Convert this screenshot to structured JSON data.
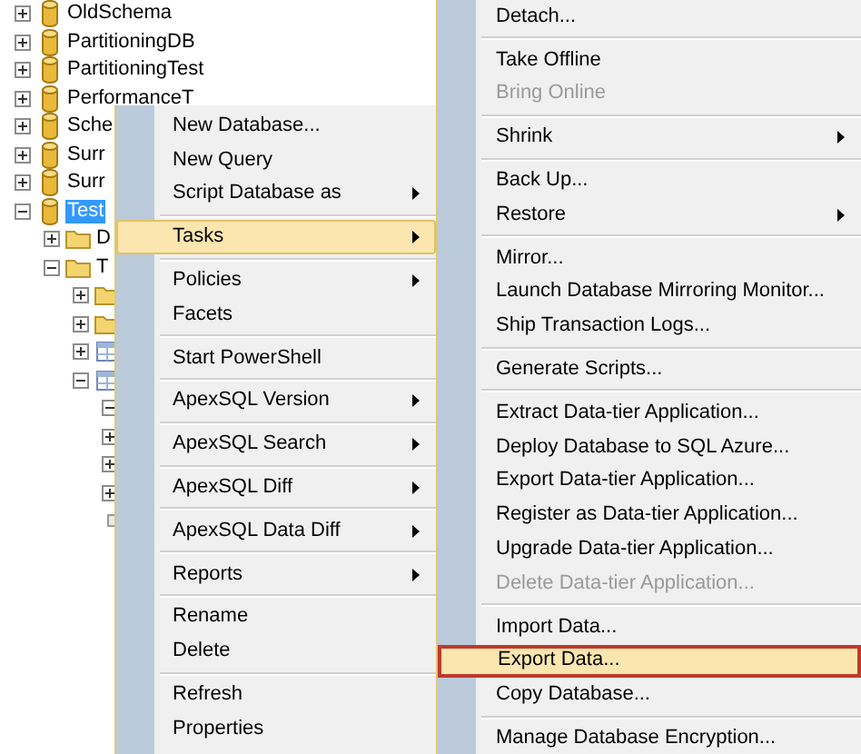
{
  "tree": [
    {
      "kind": "database",
      "label": "OldSchema",
      "expanded": false,
      "selected": false
    },
    {
      "kind": "database",
      "label": "PartitioningDB",
      "expanded": false,
      "selected": false
    },
    {
      "kind": "database",
      "label": "PartitioningTest",
      "expanded": false,
      "selected": false
    },
    {
      "kind": "database",
      "label": "PerformanceT",
      "expanded": false,
      "selected": false
    },
    {
      "kind": "database",
      "label": "Sche",
      "expanded": false,
      "selected": false
    },
    {
      "kind": "database",
      "label": "Surr",
      "expanded": false,
      "selected": false
    },
    {
      "kind": "database",
      "label": "Surr",
      "expanded": false,
      "selected": false
    },
    {
      "kind": "database",
      "label": "Test",
      "expanded": true,
      "selected": true,
      "children": [
        {
          "kind": "folder",
          "label": "D",
          "expanded": false,
          "selected": false
        },
        {
          "kind": "folder",
          "label": "T",
          "expanded": true,
          "selected": false,
          "children": [
            {
              "kind": "folder",
              "expanded": false
            },
            {
              "kind": "folder",
              "expanded": false
            },
            {
              "kind": "table",
              "expanded": false
            },
            {
              "kind": "table",
              "expanded": true,
              "children": [
                {
                  "expanded": true
                },
                {
                  "expanded": false
                },
                {
                  "expanded": false
                },
                {
                  "expanded": false
                },
                {
                  "kind": "leaf"
                }
              ]
            }
          ]
        }
      ]
    }
  ],
  "context_menu": {
    "items": [
      {
        "kind": "item",
        "label": "New Database...",
        "selected": false,
        "disabled": false,
        "submenu": false
      },
      {
        "kind": "item",
        "label": "New Query",
        "selected": false,
        "disabled": false,
        "submenu": false
      },
      {
        "kind": "item",
        "label": "Script Database as",
        "selected": false,
        "disabled": false,
        "submenu": true
      },
      {
        "kind": "separator"
      },
      {
        "kind": "item",
        "label": "Tasks",
        "selected": true,
        "disabled": false,
        "submenu": true
      },
      {
        "kind": "separator"
      },
      {
        "kind": "item",
        "label": "Policies",
        "selected": false,
        "disabled": false,
        "submenu": true
      },
      {
        "kind": "item",
        "label": "Facets",
        "selected": false,
        "disabled": false,
        "submenu": false
      },
      {
        "kind": "separator"
      },
      {
        "kind": "item",
        "label": "Start PowerShell",
        "selected": false,
        "disabled": false,
        "submenu": false
      },
      {
        "kind": "separator"
      },
      {
        "kind": "item",
        "label": "ApexSQL Version",
        "selected": false,
        "disabled": false,
        "submenu": true
      },
      {
        "kind": "separator"
      },
      {
        "kind": "item",
        "label": "ApexSQL Search",
        "selected": false,
        "disabled": false,
        "submenu": true
      },
      {
        "kind": "separator"
      },
      {
        "kind": "item",
        "label": "ApexSQL Diff",
        "selected": false,
        "disabled": false,
        "submenu": true
      },
      {
        "kind": "separator"
      },
      {
        "kind": "item",
        "label": "ApexSQL Data Diff",
        "selected": false,
        "disabled": false,
        "submenu": true
      },
      {
        "kind": "separator"
      },
      {
        "kind": "item",
        "label": "Reports",
        "selected": false,
        "disabled": false,
        "submenu": true
      },
      {
        "kind": "separator"
      },
      {
        "kind": "item",
        "label": "Rename",
        "selected": false,
        "disabled": false,
        "submenu": false
      },
      {
        "kind": "item",
        "label": "Delete",
        "selected": false,
        "disabled": false,
        "submenu": false
      },
      {
        "kind": "separator"
      },
      {
        "kind": "item",
        "label": "Refresh",
        "selected": false,
        "disabled": false,
        "submenu": false
      },
      {
        "kind": "item",
        "label": "Properties",
        "selected": false,
        "disabled": false,
        "submenu": false
      }
    ]
  },
  "tasks_submenu": {
    "items": [
      {
        "kind": "item",
        "label": "Detach...",
        "selected": false,
        "outlined": false,
        "disabled": false,
        "submenu": false
      },
      {
        "kind": "separator"
      },
      {
        "kind": "item",
        "label": "Take Offline",
        "selected": false,
        "outlined": false,
        "disabled": false,
        "submenu": false
      },
      {
        "kind": "item",
        "label": "Bring Online",
        "selected": false,
        "outlined": false,
        "disabled": true,
        "submenu": false
      },
      {
        "kind": "separator"
      },
      {
        "kind": "item",
        "label": "Shrink",
        "selected": false,
        "outlined": false,
        "disabled": false,
        "submenu": true
      },
      {
        "kind": "separator"
      },
      {
        "kind": "item",
        "label": "Back Up...",
        "selected": false,
        "outlined": false,
        "disabled": false,
        "submenu": false
      },
      {
        "kind": "item",
        "label": "Restore",
        "selected": false,
        "outlined": false,
        "disabled": false,
        "submenu": true
      },
      {
        "kind": "separator"
      },
      {
        "kind": "item",
        "label": "Mirror...",
        "selected": false,
        "outlined": false,
        "disabled": false,
        "submenu": false
      },
      {
        "kind": "item",
        "label": "Launch Database Mirroring Monitor...",
        "selected": false,
        "outlined": false,
        "disabled": false,
        "submenu": false
      },
      {
        "kind": "item",
        "label": "Ship Transaction Logs...",
        "selected": false,
        "outlined": false,
        "disabled": false,
        "submenu": false
      },
      {
        "kind": "separator"
      },
      {
        "kind": "item",
        "label": "Generate Scripts...",
        "selected": false,
        "outlined": false,
        "disabled": false,
        "submenu": false
      },
      {
        "kind": "separator"
      },
      {
        "kind": "item",
        "label": "Extract Data-tier Application...",
        "selected": false,
        "outlined": false,
        "disabled": false,
        "submenu": false
      },
      {
        "kind": "item",
        "label": "Deploy Database to SQL Azure...",
        "selected": false,
        "outlined": false,
        "disabled": false,
        "submenu": false
      },
      {
        "kind": "item",
        "label": "Export Data-tier Application...",
        "selected": false,
        "outlined": false,
        "disabled": false,
        "submenu": false
      },
      {
        "kind": "item",
        "label": "Register as Data-tier Application...",
        "selected": false,
        "outlined": false,
        "disabled": false,
        "submenu": false
      },
      {
        "kind": "item",
        "label": "Upgrade Data-tier Application...",
        "selected": false,
        "outlined": false,
        "disabled": false,
        "submenu": false
      },
      {
        "kind": "item",
        "label": "Delete Data-tier Application...",
        "selected": false,
        "outlined": false,
        "disabled": true,
        "submenu": false
      },
      {
        "kind": "separator"
      },
      {
        "kind": "item",
        "label": "Import Data...",
        "selected": false,
        "outlined": false,
        "disabled": false,
        "submenu": false
      },
      {
        "kind": "item",
        "label": "Export Data...",
        "selected": true,
        "outlined": true,
        "disabled": false,
        "submenu": false
      },
      {
        "kind": "item",
        "label": "Copy Database...",
        "selected": false,
        "outlined": false,
        "disabled": false,
        "submenu": false
      },
      {
        "kind": "separator"
      },
      {
        "kind": "item",
        "label": "Manage Database Encryption...",
        "selected": false,
        "outlined": false,
        "disabled": false,
        "submenu": false
      }
    ]
  }
}
